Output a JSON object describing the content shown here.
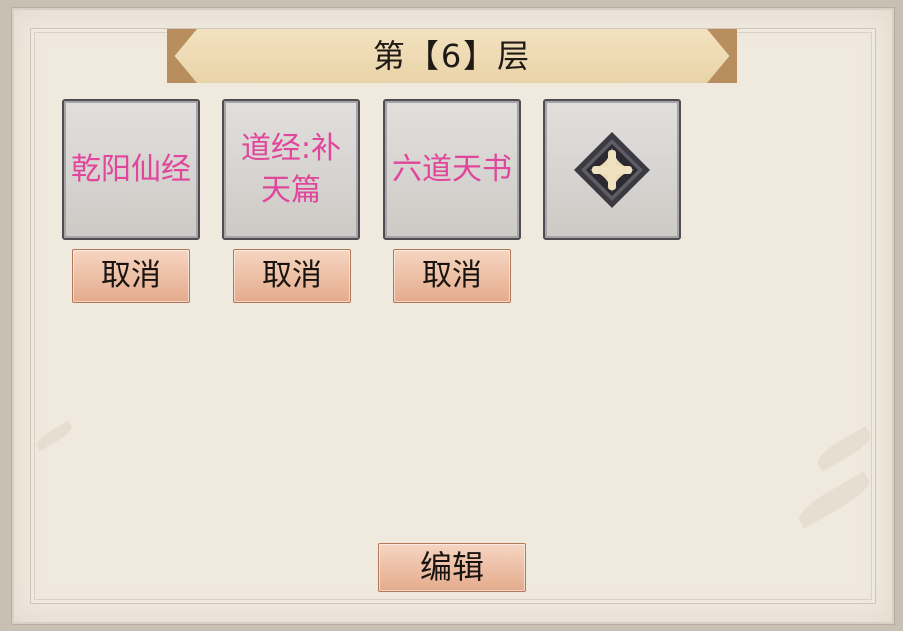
{
  "header": {
    "title": "第【6】层"
  },
  "slots": [
    {
      "name": "乾阳仙经",
      "cancel_label": "取消"
    },
    {
      "name": "道经:补天篇",
      "cancel_label": "取消"
    },
    {
      "name": "六道天书",
      "cancel_label": "取消"
    }
  ],
  "add_slot": {
    "icon": "add-icon"
  },
  "footer": {
    "edit_label": "编辑"
  },
  "colors": {
    "book_name": "#e0469b",
    "button": "#eec1a6",
    "panel": "#f0e9de",
    "banner": "#eedcb6"
  }
}
